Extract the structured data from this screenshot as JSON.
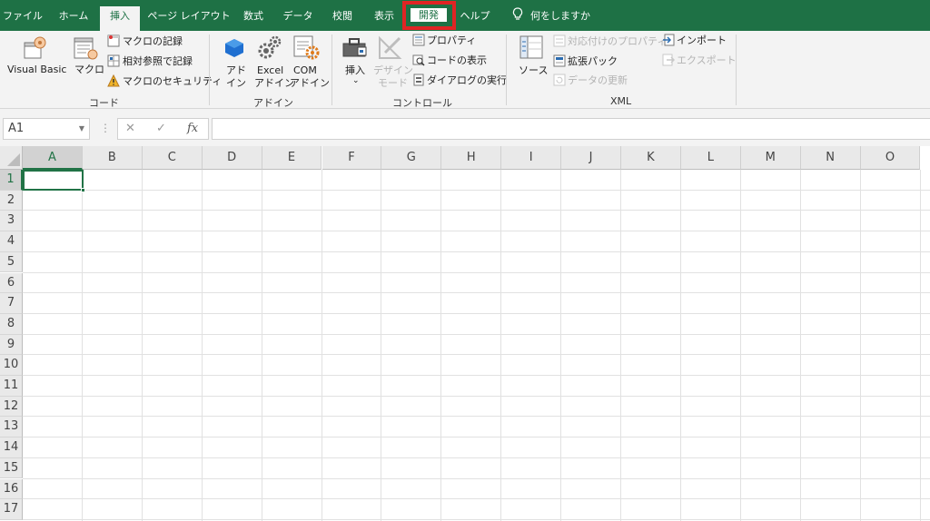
{
  "tabs": {
    "file": "ファイル",
    "home": "ホーム",
    "insert": "挿入",
    "page_layout": "ページ レイアウト",
    "formulas": "数式",
    "data": "データ",
    "review": "校閲",
    "view": "表示",
    "developer": "開発",
    "help": "ヘルプ",
    "tell_me": "何をしますか"
  },
  "ribbon": {
    "code": {
      "visual_basic": "Visual Basic",
      "macros": "マクロ",
      "record_macro": "マクロの記録",
      "relative_ref": "相対参照で記録",
      "macro_security": "マクロのセキュリティ",
      "group_label": "コード"
    },
    "addins": {
      "addin_1": "アド",
      "addin_2": "イン",
      "excel_1": "Excel",
      "excel_2": "アドイン",
      "com_1": "COM",
      "com_2": "アドイン",
      "group_label": "アドイン"
    },
    "controls": {
      "insert": "挿入",
      "design_1": "デザイン",
      "design_2": "モード",
      "properties": "プロパティ",
      "view_code": "コードの表示",
      "run_dialog": "ダイアログの実行",
      "group_label": "コントロール"
    },
    "xml": {
      "source": "ソース",
      "map_properties": "対応付けのプロパティ",
      "expansion_packs": "拡張パック",
      "refresh_data": "データの更新",
      "import": "インポート",
      "export": "エクスポート",
      "group_label": "XML"
    }
  },
  "formula_bar": {
    "name_box": "A1",
    "fx": "fx",
    "cancel": "✕",
    "enter": "✓",
    "value": ""
  },
  "sheet": {
    "columns": [
      "A",
      "B",
      "C",
      "D",
      "E",
      "F",
      "G",
      "H",
      "I",
      "J",
      "K",
      "L",
      "M",
      "N",
      "O"
    ],
    "rows": [
      "1",
      "2",
      "3",
      "4",
      "5",
      "6",
      "7",
      "8",
      "9",
      "10",
      "11",
      "12",
      "13",
      "14",
      "15",
      "16",
      "17"
    ],
    "active_cell": "A1"
  },
  "colors": {
    "accent": "#1e7145",
    "highlight": "#e02424"
  }
}
